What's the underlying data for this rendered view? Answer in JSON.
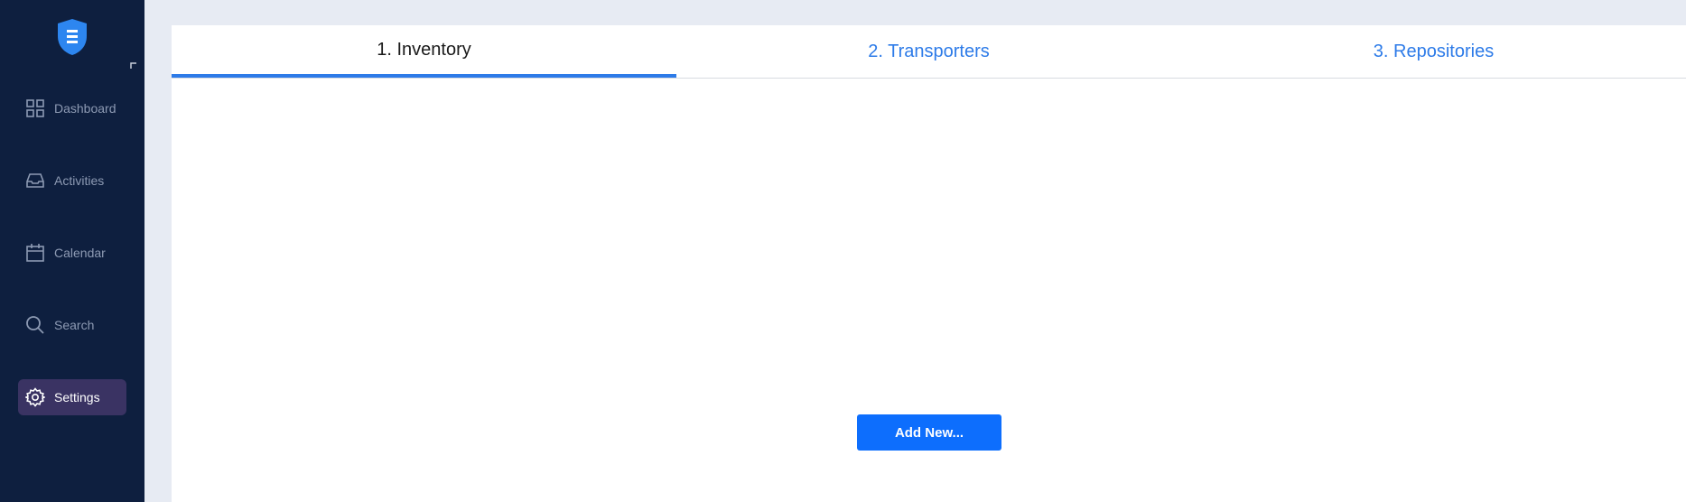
{
  "sidebar": {
    "logo_icon": "shield-icon",
    "items": [
      {
        "label": "Dashboard",
        "icon": "grid-icon",
        "active": false
      },
      {
        "label": "Activities",
        "icon": "inbox-icon",
        "active": false
      },
      {
        "label": "Calendar",
        "icon": "calendar-icon",
        "active": false
      },
      {
        "label": "Search",
        "icon": "search-icon",
        "active": false
      },
      {
        "label": "Settings",
        "icon": "gear-icon",
        "active": true
      }
    ]
  },
  "tabs": [
    {
      "label": "1. Inventory",
      "active": true
    },
    {
      "label": "2. Transporters",
      "active": false
    },
    {
      "label": "3. Repositories",
      "active": false
    }
  ],
  "main": {
    "add_button_label": "Add New..."
  },
  "colors": {
    "sidebar_bg": "#0e1f3f",
    "active_item_bg": "#3a3363",
    "accent": "#2d7be8",
    "button": "#0d6efd",
    "page_bg": "#e7ebf3"
  }
}
